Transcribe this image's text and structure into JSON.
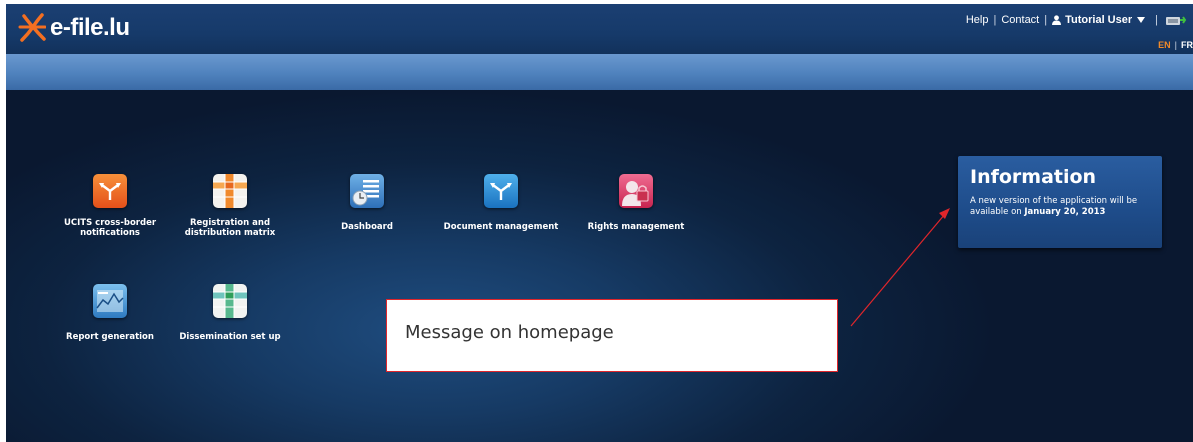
{
  "brand": {
    "logo_text": "e-file.lu"
  },
  "topnav": {
    "help": "Help",
    "contact": "Contact",
    "user": "Tutorial User",
    "separator": "|"
  },
  "lang": {
    "en": "EN",
    "fr": "FR",
    "separator": "|"
  },
  "tiles": [
    {
      "label_line1": "UCITS cross-border",
      "label_line2": "notifications",
      "icon": "share-arrows-icon",
      "color": "#ef6a24"
    },
    {
      "label_line1": "Registration and",
      "label_line2": "distribution matrix",
      "icon": "matrix-grid-icon",
      "color": "#f09a3a"
    },
    {
      "label_line1": "Dashboard",
      "label_line2": "",
      "icon": "dashboard-clock-icon",
      "color": "#3b7fc4"
    },
    {
      "label_line1": "Document management",
      "label_line2": "",
      "icon": "share-arrows-icon",
      "color": "#2c8fd6"
    },
    {
      "label_line1": "Rights management",
      "label_line2": "",
      "icon": "user-lock-icon",
      "color": "#e24a76"
    },
    {
      "label_line1": "Report generation",
      "label_line2": "",
      "icon": "chart-report-icon",
      "color": "#3a8fd0"
    },
    {
      "label_line1": "Dissemination set up",
      "label_line2": "",
      "icon": "matrix-grid-icon",
      "color": "#44b1a8"
    }
  ],
  "info": {
    "title": "Information",
    "text_prefix": "A new version of the application will be available on ",
    "date": "January 20, 2013"
  },
  "callout": {
    "text": "Message on homepage",
    "border_color": "#e0262b"
  }
}
